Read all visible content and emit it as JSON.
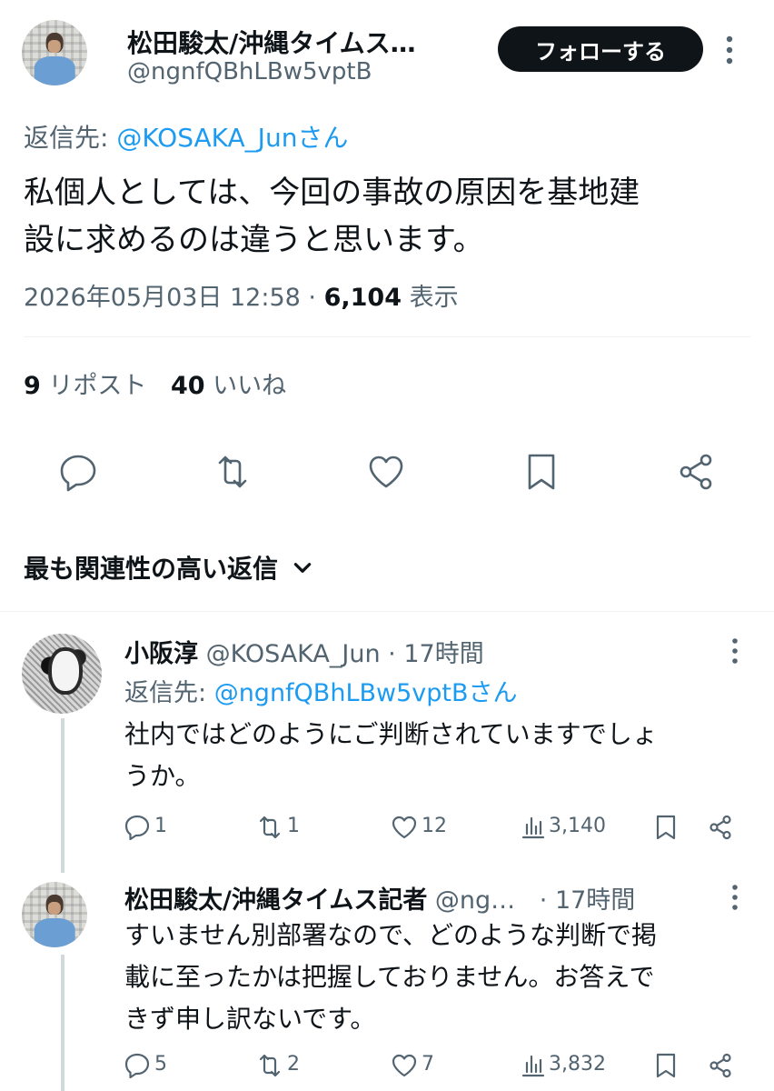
{
  "main_tweet": {
    "display_name": "松田駿太/沖縄タイムス…",
    "handle": "@ngnfQBhLBw5vptB",
    "follow_label": "フォローする",
    "reply_to_prefix": "返信先: ",
    "reply_to_user": "@KOSAKA_Junさん",
    "text_line1": "私個人としては、今回の事故の原因を基地建",
    "text_line2": "設に求めるのは違うと思います。",
    "timestamp": "2026年05月03日 12:58",
    "separator": " · ",
    "views_count": "6,104",
    "views_label": " 表示",
    "reposts_count": "9",
    "reposts_label": "リポスト",
    "likes_count": "40",
    "likes_label": "いいね"
  },
  "replies_sort": {
    "label": "最も関連性の高い返信"
  },
  "replies": [
    {
      "display_name": "小阪淳",
      "handle": "@KOSAKA_Jun",
      "time": "· 17時間",
      "reply_to_prefix": "返信先: ",
      "reply_to_user": "@ngnfQBhLBw5vptBさん",
      "text_line1": "社内ではどのようにご判断されていますでしょ",
      "text_line2": "うか。",
      "reply_count": "1",
      "repost_count": "1",
      "like_count": "12",
      "view_count": "3,140"
    },
    {
      "display_name": "松田駿太/沖縄タイムス記者",
      "handle": "@ng…",
      "time": "· 17時間",
      "text_line1": "すいません別部署なので、どのような判断で掲",
      "text_line2": "載に至ったかは把握しておりません。お答えで",
      "text_line3": "きず申し訳ないです。",
      "reply_count": "5",
      "repost_count": "2",
      "like_count": "7",
      "view_count": "3,832"
    }
  ],
  "icons": [
    "reply-icon",
    "repost-icon",
    "like-icon",
    "bookmark-icon",
    "share-icon",
    "more-icon",
    "chevron-down-icon",
    "views-icon"
  ],
  "colors": {
    "link": "#1d9bf0",
    "muted": "#536471",
    "text": "#0f1419",
    "button_bg": "#0f1419"
  }
}
